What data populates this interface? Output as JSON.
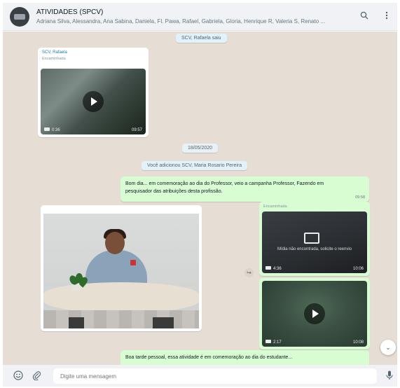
{
  "header": {
    "title": "ATIVIDADES (SPCV)",
    "subtitle": "Adriana Silva, Alessandra, Ana Sabina, Daniela, Fl. Pawa, Rafael, Gabriela, Gloria, Henrique R, Valeria S, Renato ..."
  },
  "chat": {
    "pill_top": "SCV, Rafaela saiu",
    "msg1": {
      "sender": "SCV, Rafaela",
      "forwarded": "Encaminhada",
      "duration": "0:36",
      "time": "09:57"
    },
    "date_pill": "18/05/2020",
    "system_pill": "Você adicionou SCV, Maria Rosario Pereira",
    "msg2": {
      "text": "Bom dia... em comemoração ao dia do Professor, veio a campanha Professor, Fazendo em pesquisador das atribuições desta profissão.",
      "time": "09:58"
    },
    "video_dark": {
      "forwarded": "Encaminhada",
      "notice": "Mídia não encontrada, solicite o reenvio",
      "duration": "4:36",
      "time": "10:06"
    },
    "video_green": {
      "duration": "2:17",
      "time": "10:08"
    },
    "msg3": {
      "text": "Boa tarde pessoal, essa atividade é em comemoração ao dia do estudante...",
      "subtext": ""
    }
  },
  "footer": {
    "placeholder": "Digite uma mensagem"
  },
  "icons": {
    "search": "search-icon",
    "menu": "menu-icon",
    "emoji": "emoji-icon",
    "attach": "attach-icon",
    "mic": "mic-icon",
    "forward": "forward-icon",
    "scroll_down": "chevron-down-icon"
  },
  "colors": {
    "incoming_bubble": "#ffffff",
    "outgoing_bubble": "#d9fdd3",
    "chat_background": "#e6ddd4",
    "header_background": "#f0f2f5"
  }
}
